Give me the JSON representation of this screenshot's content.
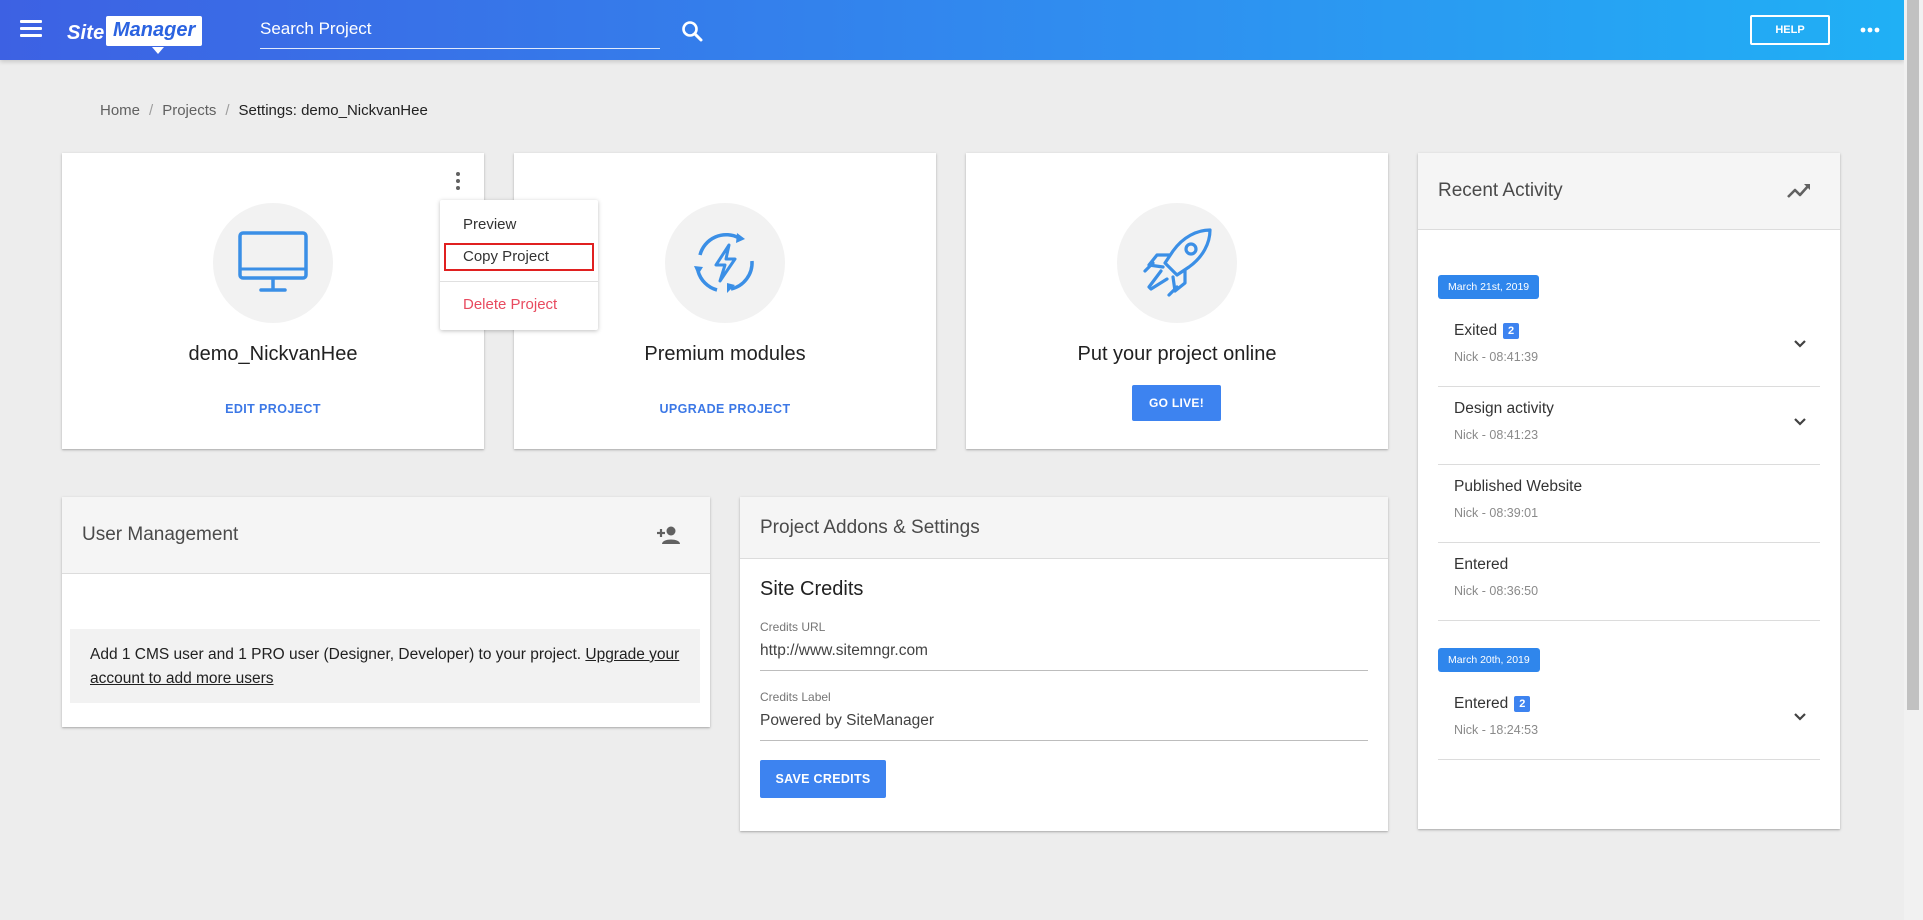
{
  "topbar": {
    "logo_word1": "Site",
    "logo_word2": "Manager",
    "search_placeholder": "Search Project",
    "help_label": "HELP"
  },
  "breadcrumb": {
    "home": "Home",
    "projects": "Projects",
    "current": "Settings: demo_NickvanHee"
  },
  "cards": {
    "project": {
      "title": "demo_NickvanHee",
      "action": "EDIT PROJECT",
      "icon": "monitor-icon"
    },
    "modules": {
      "title": "Premium modules",
      "action": "UPGRADE PROJECT",
      "icon": "energy-cycle-icon"
    },
    "online": {
      "title": "Put your project online",
      "action": "GO LIVE!",
      "icon": "rocket-icon"
    }
  },
  "dropdown": {
    "preview": "Preview",
    "copy": "Copy Project",
    "delete": "Delete Project"
  },
  "user_management": {
    "title": "User Management",
    "notice": "Add 1 CMS user and 1 PRO user (Designer, Developer) to your project.",
    "link": "Upgrade your account to add more users"
  },
  "addons": {
    "title": "Project Addons & Settings",
    "section": "Site Credits",
    "credits_url_label": "Credits URL",
    "credits_url_value": "http://www.sitemngr.com",
    "credits_label_label": "Credits Label",
    "credits_label_value": "Powered by SiteManager",
    "save_label": "SAVE CREDITS"
  },
  "activity": {
    "title": "Recent Activity",
    "groups": [
      {
        "date": "March 21st, 2019",
        "items": [
          {
            "title": "Exited",
            "badge": "2",
            "sub": "Nick - 08:41:39"
          },
          {
            "title": "Design activity",
            "badge": "",
            "sub": "Nick - 08:41:23"
          },
          {
            "title": "Published Website",
            "badge": "",
            "sub": "Nick - 08:39:01"
          },
          {
            "title": "Entered",
            "badge": "",
            "sub": "Nick - 08:36:50"
          }
        ]
      },
      {
        "date": "March 20th, 2019",
        "items": [
          {
            "title": "Entered",
            "badge": "2",
            "sub": "Nick - 18:24:53"
          }
        ]
      }
    ]
  },
  "colors": {
    "accent": "#3d83f0",
    "topbar_start": "#3d61e3",
    "topbar_end": "#20b0f5",
    "danger": "#e84a5f"
  }
}
